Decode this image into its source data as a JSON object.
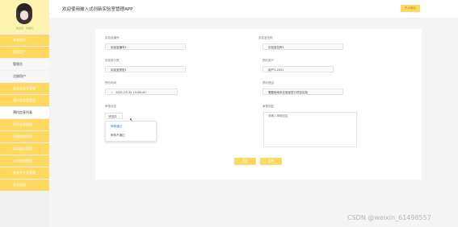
{
  "app": {
    "title": "欢迎使用嵌入式创新实验室管理APP",
    "user_button": "个人中心"
  },
  "profile": {
    "name": "欢迎您，管理员"
  },
  "sidebar": {
    "items": [
      {
        "label": "系统首页",
        "type": "main"
      },
      {
        "label": "管理用户",
        "type": "main"
      },
      {
        "label": "管理员",
        "type": "sub"
      },
      {
        "label": "注册用户",
        "type": "sub"
      },
      {
        "label": "实验室信息管理",
        "type": "main"
      },
      {
        "label": "预约实验室管理",
        "type": "main"
      },
      {
        "label": "预约信息列表",
        "type": "sub",
        "active": true
      },
      {
        "label": "科研成果管理",
        "type": "main"
      },
      {
        "label": "设备信息管理",
        "type": "main"
      },
      {
        "label": "实验报告管理",
        "type": "main"
      },
      {
        "label": "公告信息管理",
        "type": "main"
      },
      {
        "label": "实验室交流管理",
        "type": "main"
      },
      {
        "label": "系统管理",
        "type": "main"
      }
    ]
  },
  "form": {
    "lab_number": {
      "label": "实验室编号",
      "value": "实验室编号1"
    },
    "lab_name": {
      "label": "实验室名称",
      "value": "实验室名称1"
    },
    "lab_category": {
      "label": "实验室分类",
      "value": "实验室类型1"
    },
    "reserve_user": {
      "label": "预约用户",
      "value": "用户1-2021"
    },
    "reserve_time": {
      "label": "预约时间",
      "value": "2021-03-30 15:28:43"
    },
    "reserve_reason": {
      "label": "预约理由",
      "value": "需要使用本实验室进行项目实验"
    },
    "review_status": {
      "label": "审核状态",
      "value": "请选择"
    },
    "review_reply": {
      "label": "审核回复",
      "value": "请输入审核回复"
    },
    "dropdown_options": [
      "审核通过",
      "审核不通过"
    ]
  },
  "buttons": {
    "submit": "提交",
    "cancel": "取消"
  },
  "watermark": "CSDN @weixin_61498557",
  "colors": {
    "accent": "#ffd85f",
    "profile_bg": "#fdf2b0",
    "selected_option": "#3a6cc8"
  }
}
